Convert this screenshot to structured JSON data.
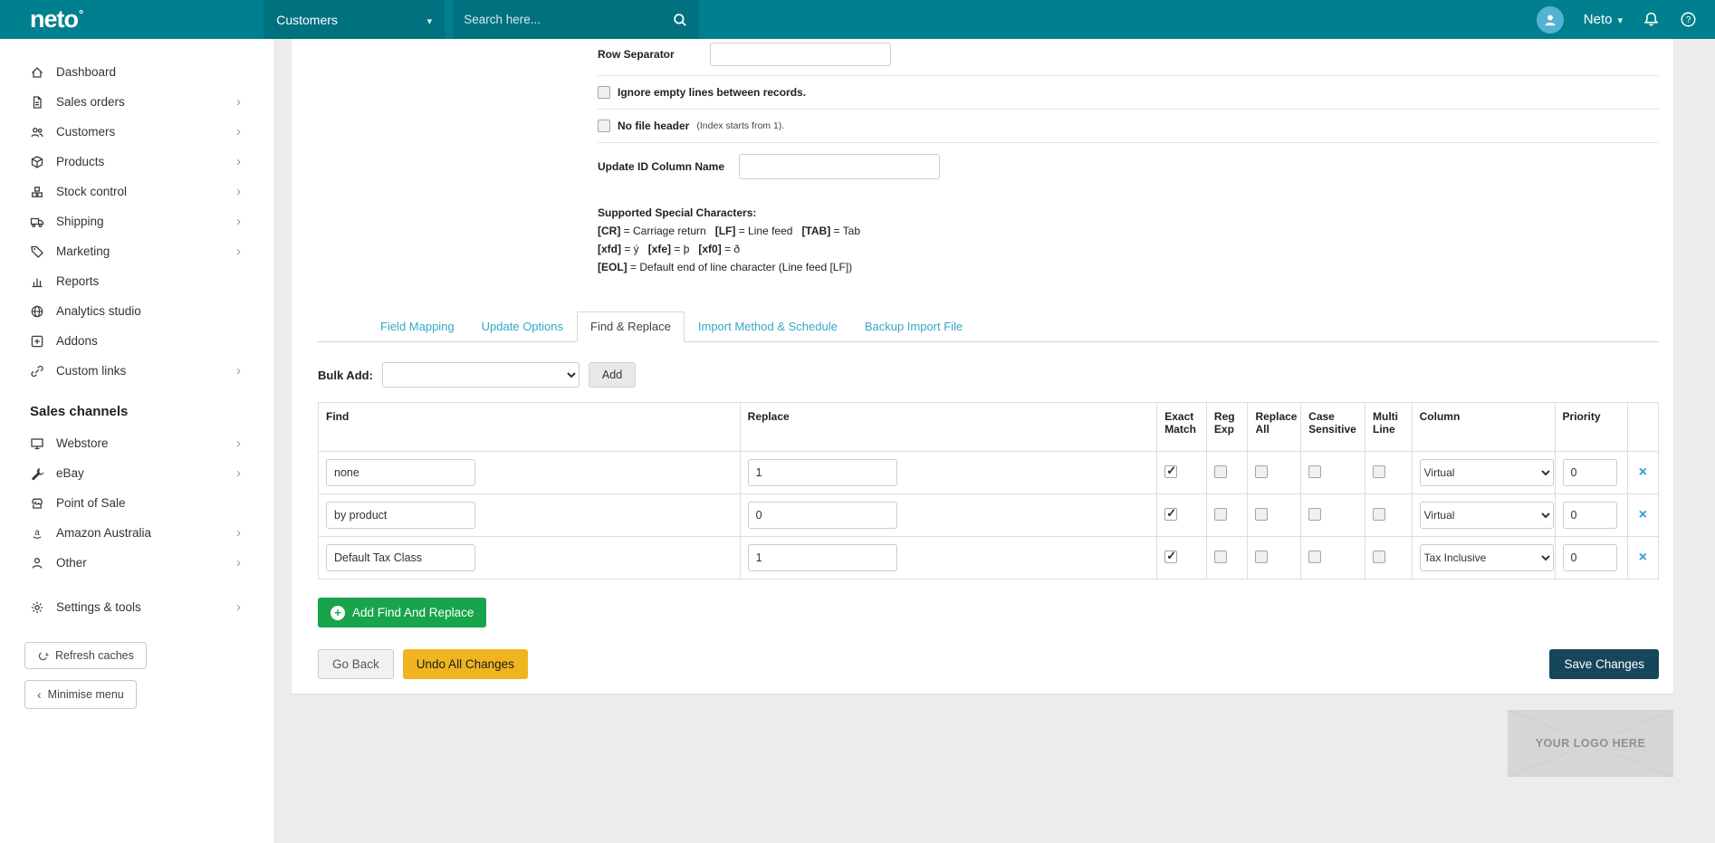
{
  "colors": {
    "brand_teal": "#00808e",
    "topbar_field_bg": "#00717e",
    "link_teal": "#35a7c6",
    "green_button": "#18a44b",
    "yellow_button": "#efb41f",
    "dark_button": "#17455c",
    "delete_blue": "#2b9fd8"
  },
  "topbar": {
    "logo": "neto",
    "context_select_value": "Customers",
    "search_placeholder": "Search here...",
    "account_label": "Neto"
  },
  "sidebar": {
    "items": [
      {
        "label": "Dashboard"
      },
      {
        "label": "Sales orders"
      },
      {
        "label": "Customers"
      },
      {
        "label": "Products"
      },
      {
        "label": "Stock control"
      },
      {
        "label": "Shipping"
      },
      {
        "label": "Marketing"
      },
      {
        "label": "Reports"
      },
      {
        "label": "Analytics studio"
      },
      {
        "label": "Addons"
      },
      {
        "label": "Custom links"
      }
    ],
    "sales_channels_header": "Sales channels",
    "channels": [
      {
        "label": "Webstore"
      },
      {
        "label": "eBay"
      },
      {
        "label": "Point of Sale"
      },
      {
        "label": "Amazon Australia"
      },
      {
        "label": "Other"
      }
    ],
    "settings_label": "Settings & tools",
    "refresh_button": "Refresh caches",
    "minimise_button": "Minimise menu"
  },
  "panel": {
    "row_separator": {
      "label": "Row Separator",
      "value": ""
    },
    "ignore_empty_label": "Ignore empty lines between records.",
    "no_file_header": {
      "label": "No file header",
      "note": "(Index starts from 1)."
    },
    "update_id": {
      "label": "Update ID Column Name",
      "value": ""
    },
    "special_characters": {
      "title": "Supported Special Characters:",
      "lines": [
        [
          {
            "text": "[CR]",
            "bold": true
          },
          {
            "text": " = Carriage return   ",
            "bold": false
          },
          {
            "text": "[LF]",
            "bold": true
          },
          {
            "text": " = Line feed   ",
            "bold": false
          },
          {
            "text": "[TAB]",
            "bold": true
          },
          {
            "text": " = Tab",
            "bold": false
          }
        ],
        [
          {
            "text": "[xfd]",
            "bold": true
          },
          {
            "text": " = ý   ",
            "bold": false
          },
          {
            "text": "[xfe]",
            "bold": true
          },
          {
            "text": " = þ   ",
            "bold": false
          },
          {
            "text": "[xf0]",
            "bold": true
          },
          {
            "text": " = ð",
            "bold": false
          }
        ],
        [
          {
            "text": "[EOL]",
            "bold": true
          },
          {
            "text": " = Default end of line character (Line feed [LF])",
            "bold": false
          }
        ]
      ]
    },
    "tabs": [
      {
        "label": "Field Mapping",
        "active": false
      },
      {
        "label": "Update Options",
        "active": false
      },
      {
        "label": "Find & Replace",
        "active": true
      },
      {
        "label": "Import Method & Schedule",
        "active": false
      },
      {
        "label": "Backup Import File",
        "active": false
      }
    ],
    "bulk_add": {
      "label": "Bulk Add:",
      "value": "",
      "add_button": "Add"
    },
    "table": {
      "headers": [
        "Find",
        "Replace",
        "Exact Match",
        "Reg Exp",
        "Replace All",
        "Case Sensitive",
        "Multi Line",
        "Column",
        "Priority"
      ],
      "rows": [
        {
          "find": "none",
          "replace": "1",
          "exact_match": true,
          "reg_exp": false,
          "replace_all": false,
          "case_sensitive": false,
          "multi_line": false,
          "column": "Virtual",
          "priority": "0"
        },
        {
          "find": "by product",
          "replace": "0",
          "exact_match": true,
          "reg_exp": false,
          "replace_all": false,
          "case_sensitive": false,
          "multi_line": false,
          "column": "Virtual",
          "priority": "0"
        },
        {
          "find": "Default Tax Class",
          "replace": "1",
          "exact_match": true,
          "reg_exp": false,
          "replace_all": false,
          "case_sensitive": false,
          "multi_line": false,
          "column": "Tax Inclusive",
          "priority": "0"
        }
      ]
    },
    "add_find_replace_button": "Add Find And Replace",
    "go_back_button": "Go Back",
    "undo_button": "Undo All Changes",
    "save_button": "Save Changes"
  },
  "footer": {
    "logo_placeholder": "YOUR LOGO HERE"
  }
}
